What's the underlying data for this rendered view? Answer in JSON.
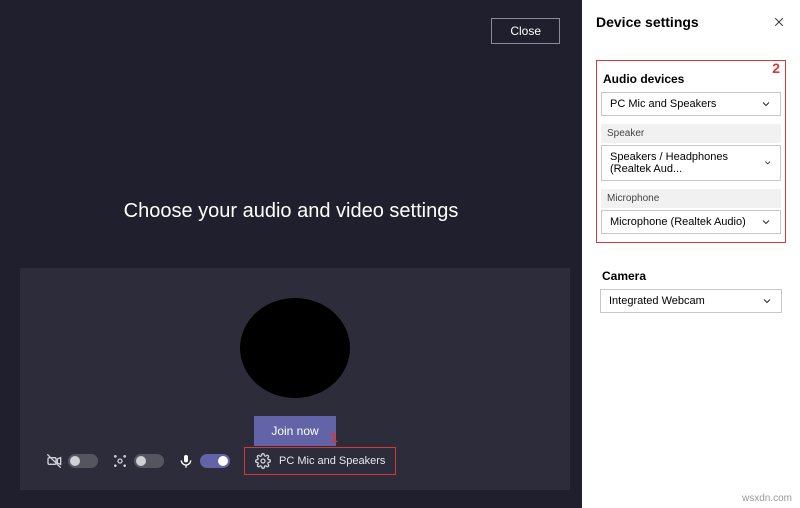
{
  "left": {
    "close_label": "Close",
    "title": "Choose your audio and video settings",
    "join_label": "Join now",
    "device_pill_label": "PC Mic and Speakers"
  },
  "annotations": {
    "one": "1",
    "two": "2"
  },
  "settings": {
    "panel_title": "Device settings",
    "audio_devices_label": "Audio devices",
    "audio_devices_value": "PC Mic and Speakers",
    "speaker_label": "Speaker",
    "speaker_value": "Speakers / Headphones (Realtek Aud...",
    "mic_label": "Microphone",
    "mic_value": "Microphone (Realtek Audio)",
    "camera_label": "Camera",
    "camera_value": "Integrated Webcam"
  },
  "watermark": "wsxdn.com"
}
